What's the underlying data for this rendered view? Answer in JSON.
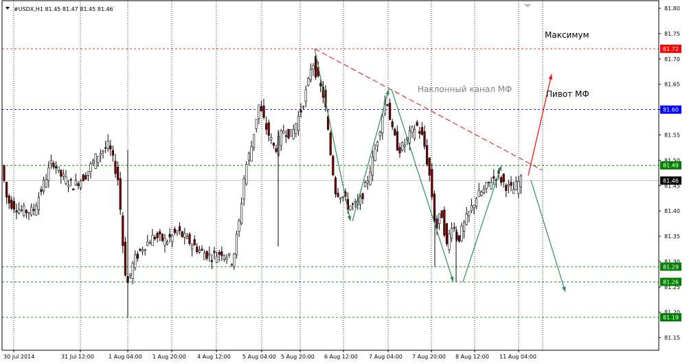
{
  "chart_data": {
    "type": "candlestick",
    "header": "#USDX,H1  81.45 81.47 81.45 81.46",
    "y_ticks": [
      "81.80",
      "81.75",
      "81.70",
      "81.65",
      "81.60",
      "81.55",
      "81.50",
      "81.45",
      "81.40",
      "81.35",
      "81.30",
      "81.25",
      "81.20",
      "81.15"
    ],
    "ylim": [
      81.125,
      81.815
    ],
    "x_ticks": [
      "30 Jul 2014",
      "31 Jul 12:00",
      "1 Aug 04:00",
      "1 Aug 20:00",
      "4 Aug 12:00",
      "5 Aug 04:00",
      "5 Aug 20:00",
      "6 Aug 12:00",
      "7 Aug 04:00",
      "7 Aug 20:00",
      "8 Aug 12:00",
      "11 Aug 04:00"
    ],
    "current_price": {
      "label": "81.46",
      "value": 81.46
    },
    "levels": [
      {
        "label": "81.72",
        "value": 81.72,
        "color": "#ff0000"
      },
      {
        "label": "81.60",
        "value": 81.6,
        "color": "#0000ff"
      },
      {
        "label": "81.49",
        "value": 81.49,
        "color": "#008000"
      },
      {
        "label": "81.29",
        "value": 81.29,
        "color": "#008000"
      },
      {
        "label": "81.26",
        "value": 81.26,
        "color": "#008000"
      },
      {
        "label": "81.19",
        "value": 81.19,
        "color": "#008000"
      }
    ],
    "annotations": [
      {
        "text": "Максимум",
        "color": "#000000"
      },
      {
        "text": "Наклонный канал МФ",
        "color": "#808080"
      },
      {
        "text": "Пивот МФ",
        "color": "#000000"
      }
    ],
    "channel_line": {
      "from": [
        81.72
      ],
      "to": [
        81.48
      ],
      "color": "#e03030"
    },
    "arrows": [
      {
        "from": 81.72,
        "to": 81.38,
        "color": "#2e8b57"
      },
      {
        "from": 81.38,
        "to": 81.64,
        "color": "#2e8b57"
      },
      {
        "from": 81.64,
        "to": 81.26,
        "color": "#2e8b57"
      },
      {
        "from": 81.26,
        "to": 81.49,
        "color": "#2e8b57"
      },
      {
        "from": 81.47,
        "to": 81.67,
        "color": "#ff0000"
      },
      {
        "from": 81.46,
        "to": 81.24,
        "color": "#2e8b57"
      }
    ],
    "colors": {
      "bull": "#008000",
      "bear": "#800000",
      "grid": "#000000",
      "text": "#000000"
    }
  }
}
